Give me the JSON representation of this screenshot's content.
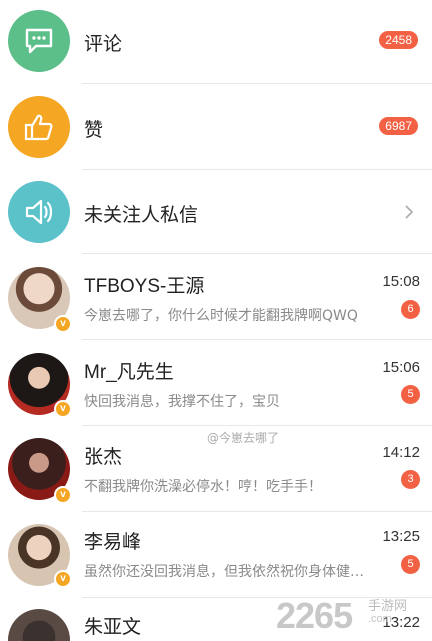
{
  "top_items": [
    {
      "label": "评论",
      "badge": "2458",
      "icon": "comment-icon",
      "color": "#5cbf8a"
    },
    {
      "label": "赞",
      "badge": "6987",
      "icon": "thumbs-up-icon",
      "color": "#f5a623"
    },
    {
      "label": "未关注人私信",
      "icon": "speaker-icon",
      "color": "#5cc2c9"
    }
  ],
  "messages": [
    {
      "name": "TFBOYS-王源",
      "time": "15:08",
      "preview": "今崽去哪了，你什么时候才能翻我牌啊QWQ",
      "count": "6",
      "verified": "v"
    },
    {
      "name": "Mr_凡先生",
      "time": "15:06",
      "preview": "快回我消息，我撑不住了，宝贝",
      "count": "5",
      "verified": "v"
    },
    {
      "name": "张杰",
      "time": "14:12",
      "preview": "不翻我牌你洗澡必停水！哼！吃手手！",
      "count": "3",
      "verified": "v"
    },
    {
      "name": "李易峰",
      "time": "13:25",
      "preview": "虽然你还没回我消息，但我依然祝你身体健…",
      "count": "5",
      "verified": "v"
    },
    {
      "name": "朱亚文",
      "time": "13:22"
    }
  ],
  "watermark": "@今崽去哪了",
  "brand": {
    "number": "2265",
    "suffix": ".com",
    "text": "手游网"
  },
  "colors": {
    "badge": "#f26144",
    "verified": "#f5a623"
  }
}
